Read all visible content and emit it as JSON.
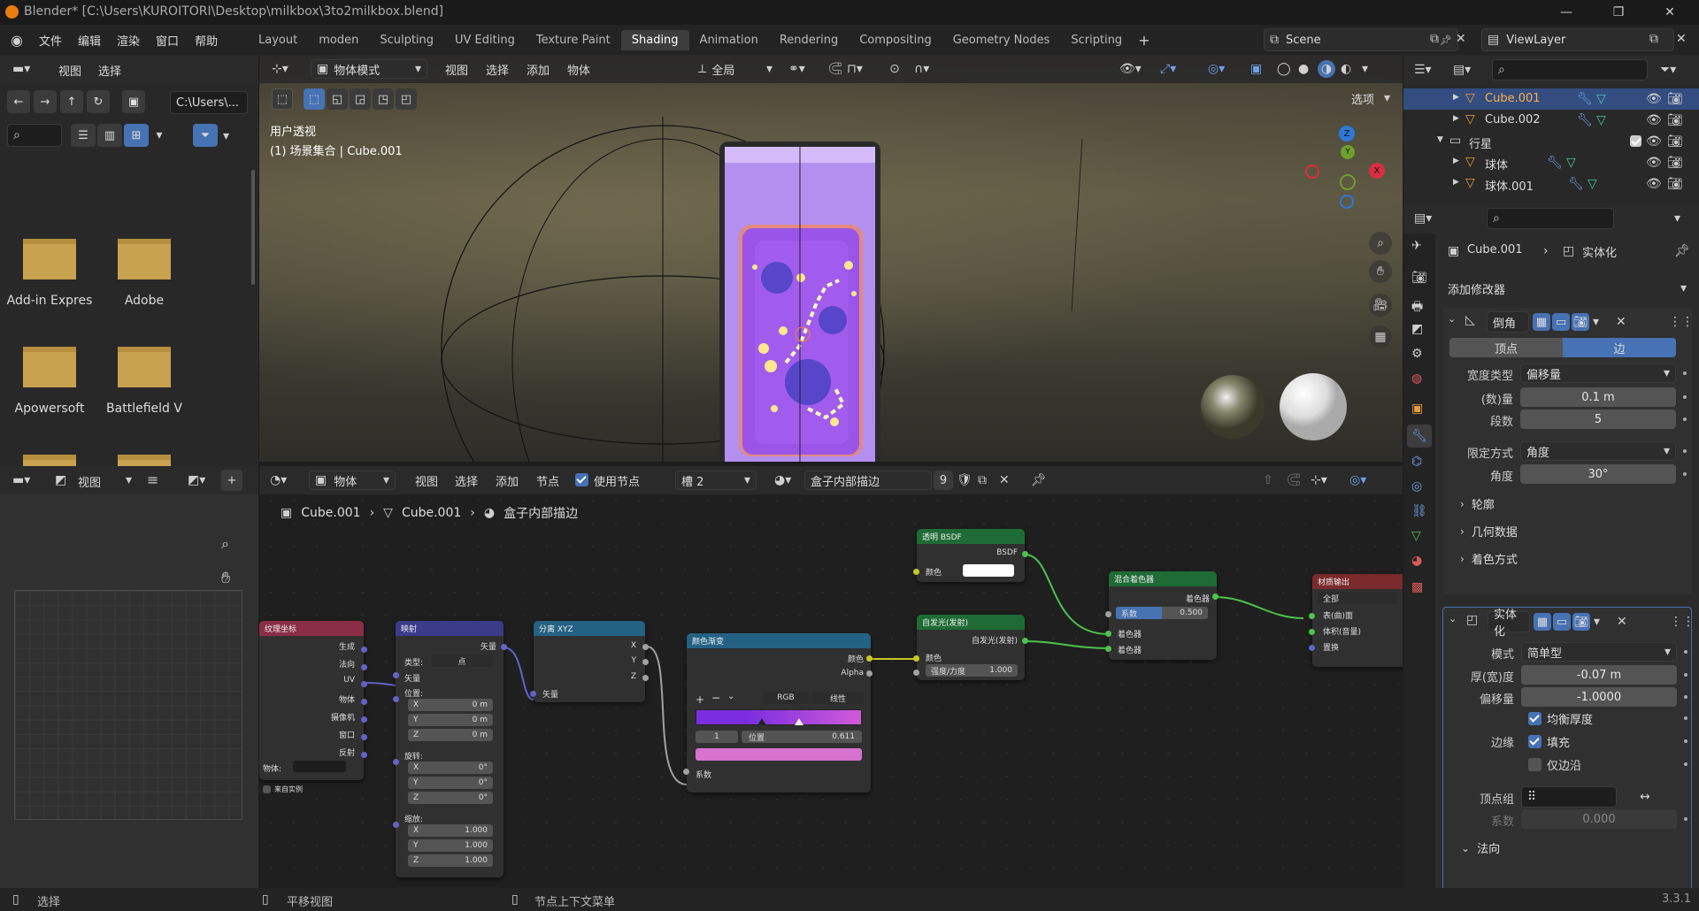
{
  "window": {
    "title": "Blender* [C:\\Users\\KUROITORI\\Desktop\\milkbox\\3to2milkbox.blend]"
  },
  "menu": [
    "文件",
    "编辑",
    "渲染",
    "窗口",
    "帮助"
  ],
  "workspaces": [
    "Layout",
    "moden",
    "Sculpting",
    "UV Editing",
    "Texture Paint",
    "Shading",
    "Animation",
    "Rendering",
    "Compositing",
    "Geometry Nodes",
    "Scripting"
  ],
  "active_workspace": "Shading",
  "scene": {
    "name": "Scene",
    "view_layer": "ViewLayer"
  },
  "file_browser": {
    "menu": [
      "视图",
      "选择"
    ],
    "path": "C:\\Users\\...",
    "folders": [
      "Add-in Expres",
      "Adobe",
      "Apowersoft",
      "Battlefield V",
      "",
      ""
    ]
  },
  "viewport": {
    "mode": "物体模式",
    "menu": [
      "视图",
      "选择",
      "添加",
      "物体"
    ],
    "transform": "全局",
    "options": "选项",
    "info_line1": "用户透视",
    "info_line2": "(1) 场景集合 | Cube.001",
    "gizmo": {
      "z": "Z",
      "y": "Y",
      "x": "X"
    }
  },
  "image_editor": {
    "menu": "视图"
  },
  "node_editor": {
    "object_label": "物体",
    "menu": [
      "视图",
      "选择",
      "添加",
      "节点"
    ],
    "use_nodes": "使用节点",
    "slot": "槽 2",
    "material": "盒子内部描边",
    "users": "9",
    "breadcrumb": [
      "Cube.001",
      "Cube.001",
      "盒子内部描边"
    ]
  },
  "nodes": {
    "texcoord": {
      "title": "纹理坐标",
      "outputs": [
        "生成",
        "法向",
        "UV",
        "物体",
        "摄像机",
        "窗口",
        "反射"
      ],
      "object_label": "物体:",
      "from_instancer": "来自实例"
    },
    "mapping": {
      "title": "映射",
      "out": "矢量",
      "type_label": "类型:",
      "type": "点",
      "vector": "矢量",
      "loc": "位置:",
      "rot": "旋转:",
      "scale": "缩放:",
      "loc_vals": [
        [
          "X",
          "0 m"
        ],
        [
          "Y",
          "0 m"
        ],
        [
          "Z",
          "0 m"
        ]
      ],
      "rot_vals": [
        [
          "X",
          "0°"
        ],
        [
          "Y",
          "0°"
        ],
        [
          "Z",
          "0°"
        ]
      ],
      "scale_vals": [
        [
          "X",
          "1.000"
        ],
        [
          "Y",
          "1.000"
        ],
        [
          "Z",
          "1.000"
        ]
      ]
    },
    "separate": {
      "title": "分离 XYZ",
      "outputs": [
        "X",
        "Y",
        "Z"
      ],
      "input": "矢量"
    },
    "ramp": {
      "title": "颜色渐变",
      "out_color": "颜色",
      "out_alpha": "Alpha",
      "mode": "RGB",
      "interp": "线性",
      "index": "1",
      "pos_label": "位置",
      "pos": "0.611",
      "fac": "系数",
      "color_start": "#7a2ee0",
      "color_end": "#d25ad8",
      "selected_color": "#d772cf"
    },
    "transparent": {
      "title": "透明 BSDF",
      "out": "BSDF",
      "color": "颜色"
    },
    "emission": {
      "title": "自发光(发射)",
      "out": "自发光(发射)",
      "color": "颜色",
      "strength_label": "强度/力度",
      "strength": "1.000"
    },
    "mix": {
      "title": "混合着色器",
      "out": "着色器",
      "fac_label": "系数",
      "fac": "0.500",
      "in1": "着色器",
      "in2": "着色器"
    },
    "output": {
      "title": "材质输出",
      "target": "全部",
      "surface": "表(曲)面",
      "volume": "体积(音量)",
      "disp": "置换"
    }
  },
  "outliner": {
    "items": [
      {
        "name": "Cube.001",
        "selected": true
      },
      {
        "name": "Cube.002",
        "selected": false
      },
      {
        "name": "行星",
        "collection": true
      },
      {
        "name": "球体",
        "selected": false
      },
      {
        "name": "球体.001",
        "selected": false
      }
    ]
  },
  "properties": {
    "object": "Cube.001",
    "modifier_crumb": "实体化",
    "add_modifier": "添加修改器",
    "bevel": {
      "name": "倒角",
      "tab_vertex": "顶点",
      "tab_edge": "边",
      "width_type_label": "宽度类型",
      "width_type": "偏移量",
      "amount_label": "(数)量",
      "amount": "0.1 m",
      "segments_label": "段数",
      "segments": "5",
      "limit_label": "限定方式",
      "limit": "角度",
      "angle_label": "角度",
      "angle": "30°",
      "sub": [
        "轮廓",
        "几何数据",
        "着色方式"
      ]
    },
    "solidify": {
      "name": "实体化",
      "mode_label": "模式",
      "mode": "简单型",
      "thickness_label": "厚(宽)度",
      "thickness": "-0.07 m",
      "offset_label": "偏移量",
      "offset": "-1.0000",
      "even": "均衡厚度",
      "rim_label": "边缘",
      "fill": "填充",
      "only_rim": "仅边沿",
      "vgroup_label": "顶点组",
      "factor_label": "系数",
      "factor": "0.000",
      "normals": "法向"
    }
  },
  "status": {
    "select": "选择",
    "pan": "平移视图",
    "context": "节点上下文菜单",
    "version": "3.3.1"
  }
}
